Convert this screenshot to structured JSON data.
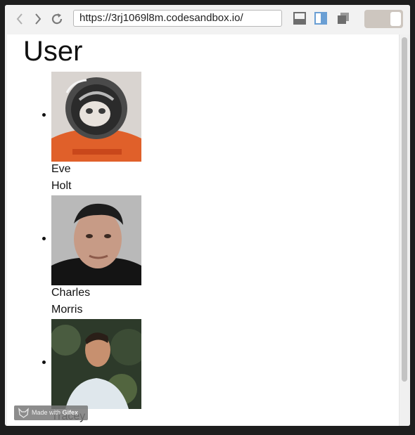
{
  "browser": {
    "url": "https://3rj1069l8m.codesandbox.io/",
    "icons": {
      "back": "chevron-left-icon",
      "forward": "chevron-right-icon",
      "reload": "reload-icon",
      "layout_bottom": "dock-bottom-icon",
      "layout_side": "dock-side-icon",
      "layout_window": "window-icon"
    },
    "accent": "#6a9fd4"
  },
  "page": {
    "title": "User",
    "users": [
      {
        "first_name": "Eve",
        "last_name": "Holt",
        "avatar": "astronaut-cat-photo"
      },
      {
        "first_name": "Charles",
        "last_name": "Morris",
        "avatar": "man-portrait-photo"
      },
      {
        "first_name": "Tracey",
        "last_name": "",
        "avatar": "man-outdoor-photo"
      }
    ]
  },
  "watermark": {
    "prefix": "Made with ",
    "brand": "Gifex"
  }
}
